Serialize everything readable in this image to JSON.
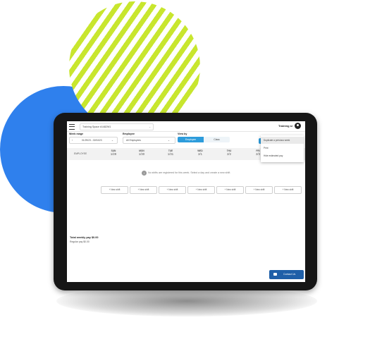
{
  "workspace": {
    "name": "Training Space #1482W1"
  },
  "user": {
    "name": "Training si"
  },
  "filters": {
    "week_range_label": "Week range",
    "week_range_value": "01/29/23 - 02/04/23",
    "employee_label": "Employee",
    "employee_value": "All Employees",
    "view_by_label": "View by",
    "view_by_options": [
      "Employee",
      "Class"
    ]
  },
  "menu": {
    "items": [
      "Duplicate a previous week",
      "Print",
      "Hide estimated pay"
    ]
  },
  "schedule": {
    "employee_col": "EMPLOYEE",
    "days": [
      {
        "name": "SUN",
        "date": "1/29"
      },
      {
        "name": "MON",
        "date": "1/30"
      },
      {
        "name": "TUE",
        "date": "1/31"
      },
      {
        "name": "WED",
        "date": "2/1"
      },
      {
        "name": "THU",
        "date": "2/2"
      },
      {
        "name": "FRI",
        "date": "2/3"
      }
    ],
    "empty_message": "No shifts are registered for this week. Select a day and create a new shift.",
    "new_shift_label": "+ New shift"
  },
  "totals": {
    "weekly_pay": "Total weekly pay $0.00",
    "regular_pay": "Regular pay $0.00"
  },
  "contact": {
    "label": "Contact Us"
  },
  "colors": {
    "accent": "#2d9cdb",
    "blue_circle": "#2f80ed",
    "lime": "#c8e62e",
    "button": "#1f5fa8"
  }
}
